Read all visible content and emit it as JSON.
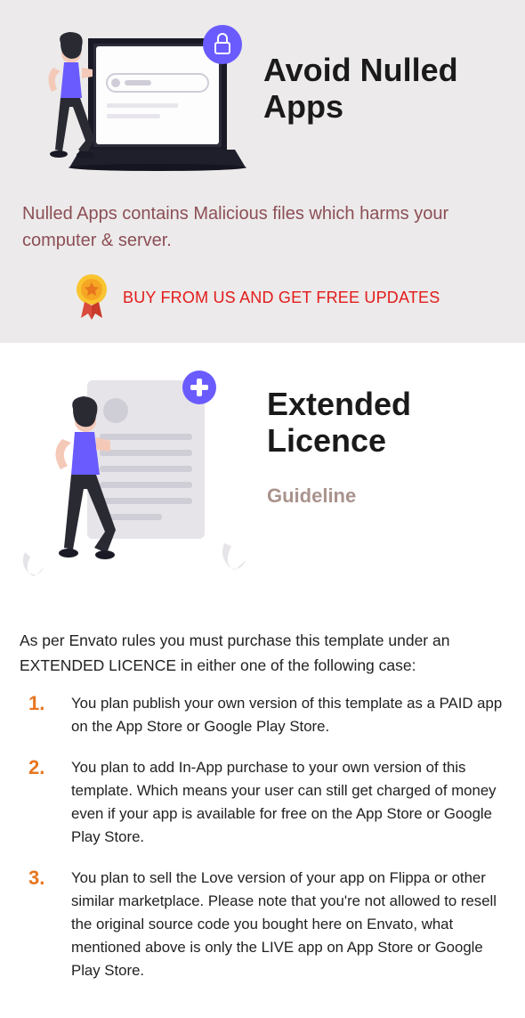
{
  "nulled": {
    "title": "Avoid Nulled Apps",
    "description": "Nulled Apps contains Malicious files which harms your computer & server.",
    "cta": "BUY FROM US AND GET FREE UPDATES"
  },
  "licence": {
    "title": "Extended Licence",
    "subtitle": "Guideline",
    "intro": "As per Envato rules you must purchase this template under an EXTENDED LICENCE in either one of the following case:",
    "items": [
      "You plan publish your own version of this template as a PAID app on the App Store or Google Play Store.",
      "You plan to add In-App purchase to your own version of this template. Which means your user can still get charged of money even if your app is available for free on the App Store or Google Play Store.",
      "You plan to sell the Love version of your app on Flippa or other similar marketplace. Please note that you're not allowed to resell the original source code you bought here on Envato, what mentioned above is only the LIVE app on App Store or Google Play Store."
    ]
  }
}
